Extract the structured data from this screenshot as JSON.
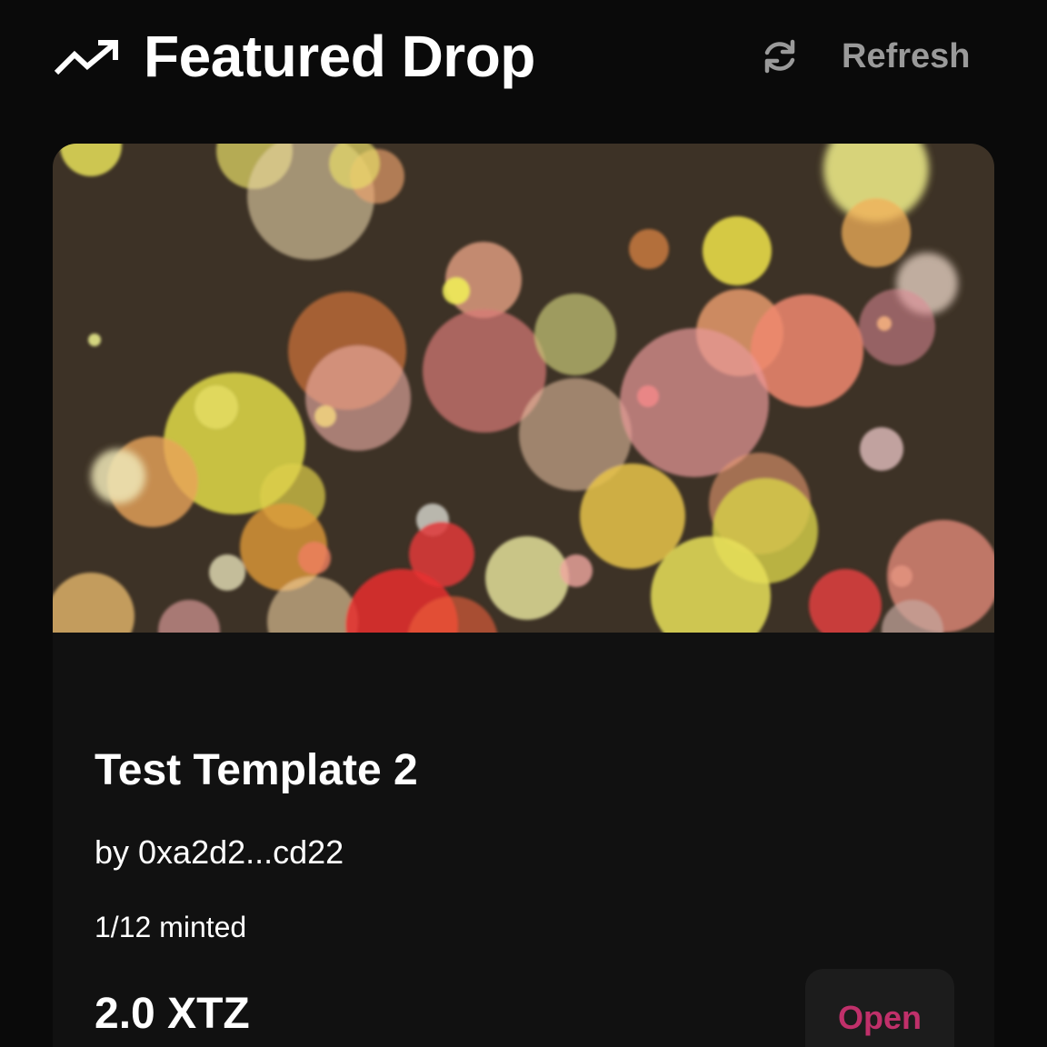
{
  "header": {
    "title": "Featured Drop",
    "icon": "trending-up-icon",
    "refresh_label": "Refresh",
    "refresh_icon": "refresh-icon"
  },
  "drop": {
    "title": "Test Template 2",
    "creator": "by 0xa2d2...cd22",
    "minted": "1/12 minted",
    "price": "2.0 XTZ",
    "action_label": "Open",
    "artwork": "bokeh-lights-artwork"
  },
  "colors": {
    "background": "#0a0a0a",
    "card": "#111111",
    "open_accent": "#c0306a",
    "refresh_text": "#9a9a9a",
    "artwork_background": "#3d3226"
  }
}
